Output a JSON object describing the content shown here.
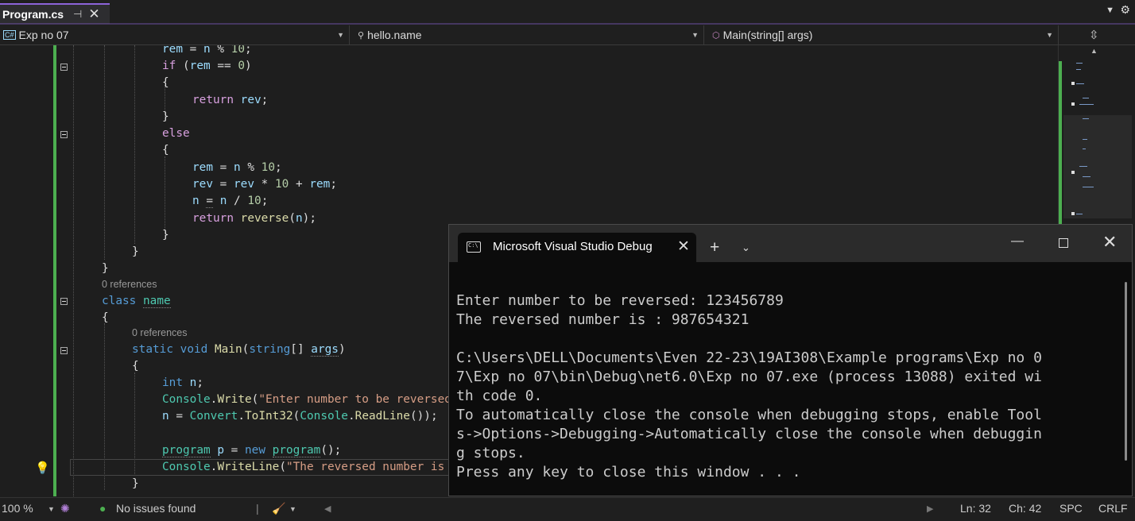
{
  "tab": {
    "label": "Program.cs",
    "pin": "⊣",
    "close": "✕"
  },
  "nav": {
    "project": "Exp no 07",
    "project_icon": "C#",
    "class": "hello.name",
    "method": "Main(string[] args)"
  },
  "editor": {
    "codelens_1": "0 references",
    "codelens_2": "0 references"
  },
  "status": {
    "zoom": "100 %",
    "issues": "No issues found",
    "line": "Ln: 32",
    "col": "Ch: 42",
    "spc": "SPC",
    "eol": "CRLF"
  },
  "console": {
    "title": "Microsoft Visual Studio Debug Console",
    "lines": [
      "Enter number to be reversed: 123456789",
      "The reversed number is : 987654321",
      "",
      "C:\\Users\\DELL\\Documents\\Even 22-23\\19AI308\\Example programs\\Exp no 0",
      "7\\Exp no 07\\bin\\Debug\\net6.0\\Exp no 07.exe (process 13088) exited wi",
      "th code 0.",
      "To automatically close the console when debugging stops, enable Tool",
      "s->Options->Debugging->Automatically close the console when debuggin",
      "g stops.",
      "Press any key to close this window . . ."
    ]
  },
  "colors": {
    "accent": "#8c63d9",
    "changebar": "#4caf50",
    "console_bg": "#0c0c0c"
  }
}
